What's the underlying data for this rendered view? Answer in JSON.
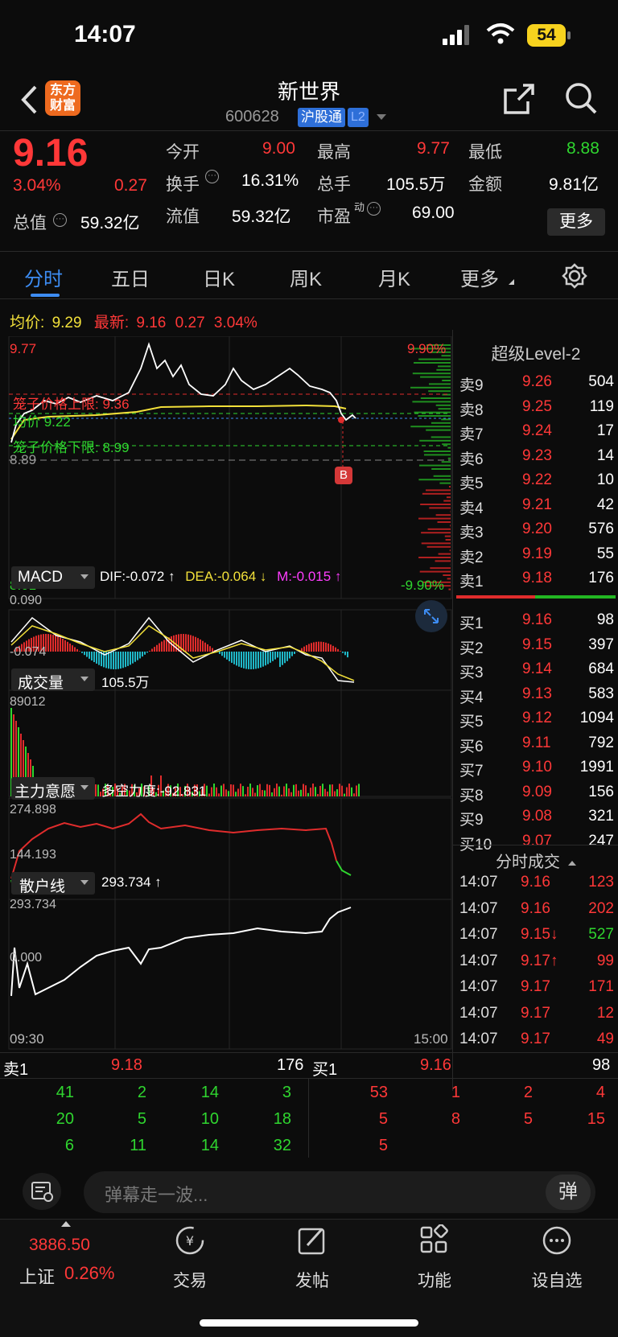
{
  "status_bar": {
    "time": "14:07",
    "battery": "54"
  },
  "header": {
    "stock_name": "新世界",
    "stock_code": "600628",
    "badge_connect": "沪股通",
    "badge_level": "L2",
    "logo_line1": "东方",
    "logo_line2": "财富"
  },
  "quote": {
    "price": "9.16",
    "change_pct": "3.04%",
    "change": "0.27",
    "open_label": "今开",
    "open": "9.00",
    "high_label": "最高",
    "high": "9.77",
    "low_label": "最低",
    "low": "8.88",
    "turnover_label": "换手",
    "turnover": "16.31%",
    "volume_label": "总手",
    "volume": "105.5万",
    "amount_label": "金额",
    "amount": "9.81亿",
    "total_cap_label": "总值",
    "total_cap": "59.32亿",
    "float_cap_label": "流值",
    "float_cap": "59.32亿",
    "pe_label": "市盈",
    "pe_sup": "动",
    "pe": "69.00",
    "more_button": "更多"
  },
  "tabs": [
    "分时",
    "五日",
    "日K",
    "周K",
    "月K",
    "更多"
  ],
  "chart_info": {
    "avg_label": "均价:",
    "avg": "9.29",
    "latest_label": "最新:",
    "latest": "9.16",
    "latest_change": "0.27",
    "latest_pct": "3.04%",
    "y_top": "9.77",
    "y_bottom": "8.01",
    "pct_top": "9.90%",
    "pct_bottom": "-9.90%",
    "upper_limit_text": "笼子价格上限: 9.36",
    "avg_price_text": "均价 9.22",
    "lower_limit_text": "笼子价格下限: 8.99",
    "ref_price": "8.89",
    "buy_marker": "B"
  },
  "macd": {
    "label": "MACD",
    "dif": "DIF:-0.072 ↑",
    "dea": "DEA:-0.064 ↓",
    "m": "M:-0.015 ↑",
    "y_top": "0.090",
    "y_bottom": "-0.074"
  },
  "volume_panel": {
    "label": "成交量",
    "value": "105.5万",
    "y_top": "89012"
  },
  "main_force": {
    "label": "主力意愿",
    "value": "多空力度:-92.831",
    "y_top": "274.898",
    "y_bottom": "144.193"
  },
  "retail": {
    "label": "散户线",
    "value": "293.734 ↑",
    "y_top": "293.734",
    "y_bottom": "0.000"
  },
  "time_axis": {
    "start": "09:30",
    "end": "15:00"
  },
  "order_book": {
    "title": "超级Level-2",
    "asks": [
      {
        "label": "卖9",
        "price": "9.26",
        "vol": "504"
      },
      {
        "label": "卖8",
        "price": "9.25",
        "vol": "119"
      },
      {
        "label": "卖7",
        "price": "9.24",
        "vol": "17"
      },
      {
        "label": "卖6",
        "price": "9.23",
        "vol": "14"
      },
      {
        "label": "卖5",
        "price": "9.22",
        "vol": "10"
      },
      {
        "label": "卖4",
        "price": "9.21",
        "vol": "42"
      },
      {
        "label": "卖3",
        "price": "9.20",
        "vol": "576"
      },
      {
        "label": "卖2",
        "price": "9.19",
        "vol": "55"
      },
      {
        "label": "卖1",
        "price": "9.18",
        "vol": "176"
      }
    ],
    "bids": [
      {
        "label": "买1",
        "price": "9.16",
        "vol": "98"
      },
      {
        "label": "买2",
        "price": "9.15",
        "vol": "397"
      },
      {
        "label": "买3",
        "price": "9.14",
        "vol": "684"
      },
      {
        "label": "买4",
        "price": "9.13",
        "vol": "583"
      },
      {
        "label": "买5",
        "price": "9.12",
        "vol": "1094"
      },
      {
        "label": "买6",
        "price": "9.11",
        "vol": "792"
      },
      {
        "label": "买7",
        "price": "9.10",
        "vol": "1991"
      },
      {
        "label": "买8",
        "price": "9.09",
        "vol": "156"
      },
      {
        "label": "买9",
        "price": "9.08",
        "vol": "321"
      },
      {
        "label": "买10",
        "price": "9.07",
        "vol": "247"
      }
    ],
    "trades_title": "分时成交",
    "trades": [
      {
        "time": "14:07",
        "price": "9.16",
        "vol": "123"
      },
      {
        "time": "14:07",
        "price": "9.16",
        "vol": "202"
      },
      {
        "time": "14:07",
        "price": "9.15↓",
        "vol": "527"
      },
      {
        "time": "14:07",
        "price": "9.17↑",
        "vol": "99"
      },
      {
        "time": "14:07",
        "price": "9.17",
        "vol": "171"
      },
      {
        "time": "14:07",
        "price": "9.17",
        "vol": "12"
      },
      {
        "time": "14:07",
        "price": "9.17",
        "vol": "49"
      }
    ]
  },
  "tick_queue": {
    "ask_label": "卖1",
    "ask_price": "9.18",
    "ask_vol": "176",
    "bid_label": "买1",
    "bid_price": "9.16",
    "bid_vol": "98",
    "ask_orders": [
      "41",
      "2",
      "14",
      "3",
      "20",
      "5",
      "10",
      "18",
      "6",
      "11",
      "14",
      "32"
    ],
    "bid_orders": [
      "53",
      "1",
      "2",
      "4",
      "5",
      "8",
      "5",
      "15",
      "5"
    ]
  },
  "comment": {
    "placeholder": "弹幕走一波...",
    "send_icon_char": "弹"
  },
  "bottom_nav": {
    "index_value": "3886.50",
    "index_name": "上证",
    "index_pct": "0.26%",
    "items": [
      "交易",
      "发帖",
      "功能",
      "设自选"
    ]
  }
}
